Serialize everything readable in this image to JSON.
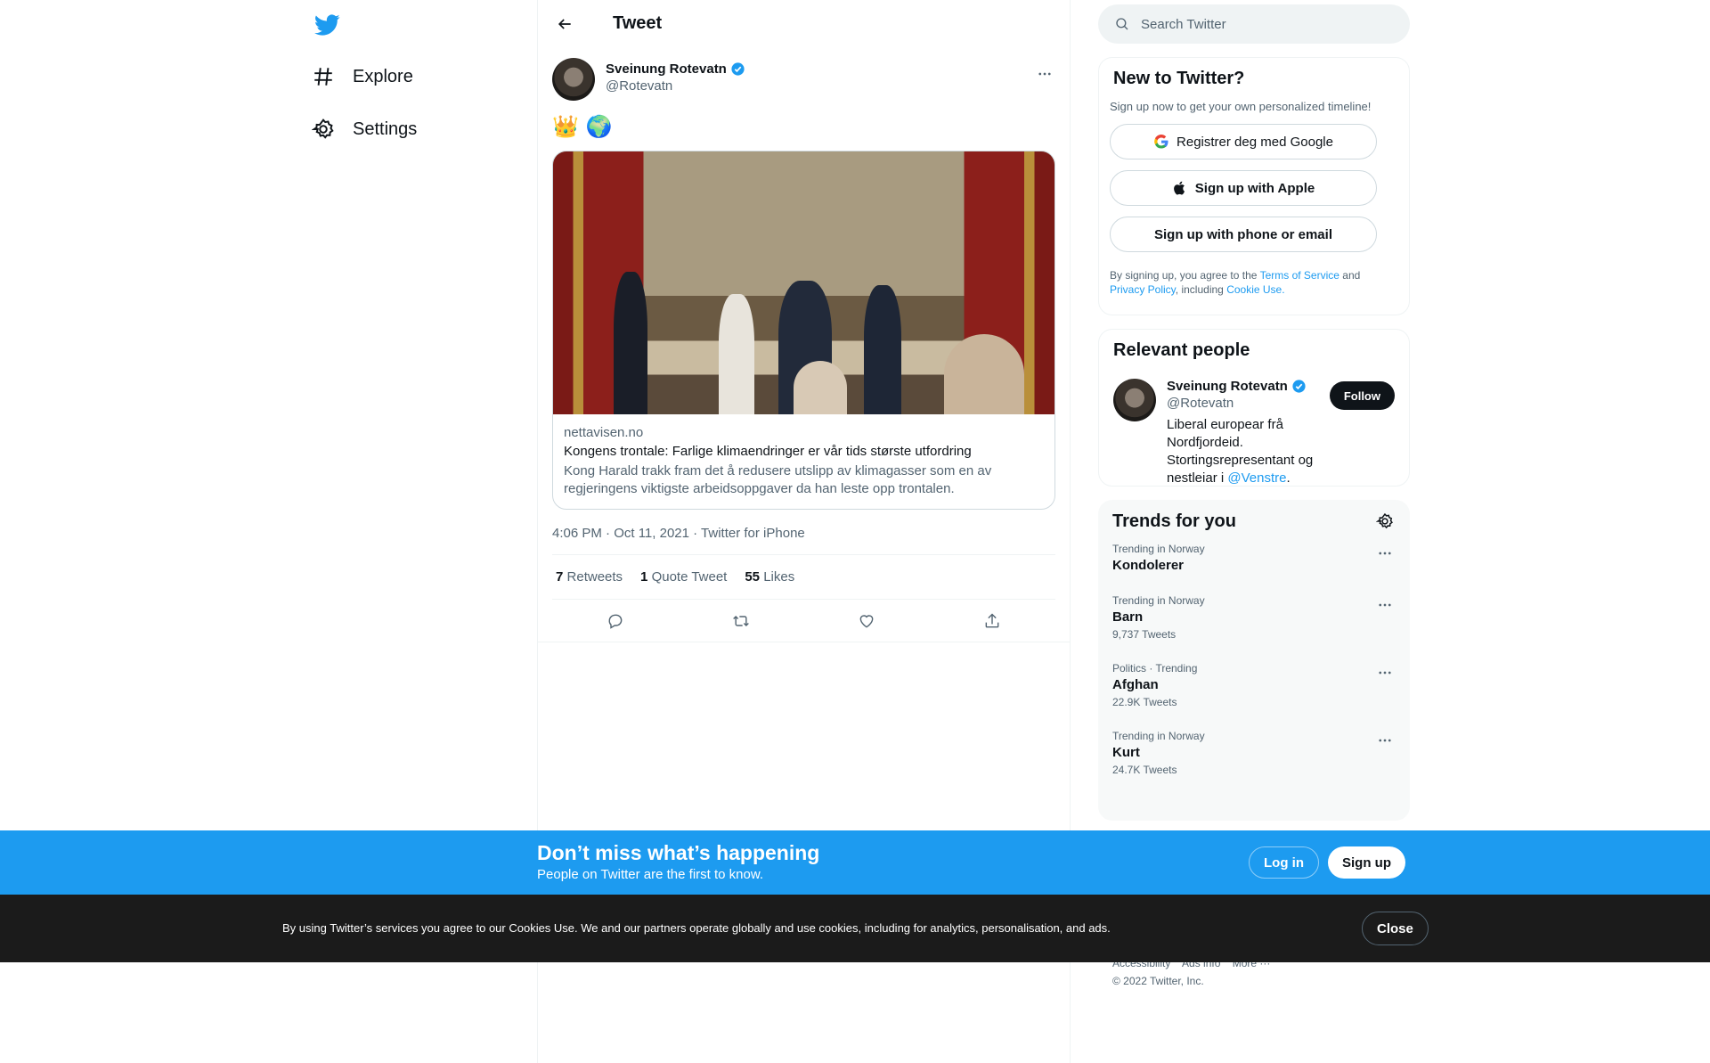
{
  "nav": {
    "items": [
      {
        "label": "Explore",
        "icon": "hashtag-icon"
      },
      {
        "label": "Settings",
        "icon": "gear-icon"
      }
    ]
  },
  "header": {
    "title": "Tweet"
  },
  "tweet": {
    "author_name": "Sveinung Rotevatn",
    "author_handle": "@Rotevatn",
    "emojis": [
      "👑",
      "🌍"
    ],
    "card": {
      "domain": "nettavisen.no",
      "title": "Kongens trontale: Farlige klimaendringer er vår tids største utfordring",
      "description": "Kong Harald trakk fram det å redusere utslipp av klimagasser som en av regjeringens viktigste arbeidsoppgaver da han leste opp trontalen."
    },
    "timestamp": "4:06 PM · Oct 11, 2021 · Twitter for iPhone",
    "stats": {
      "retweets_num": "7",
      "retweets_label": "Retweets",
      "quotes_num": "1",
      "quotes_label": "Quote Tweet",
      "likes_num": "55",
      "likes_label": "Likes"
    }
  },
  "search": {
    "placeholder": "Search Twitter"
  },
  "signup_panel": {
    "title": "New to Twitter?",
    "subtitle": "Sign up now to get your own personalized timeline!",
    "google_label": "Registrer deg med Google",
    "apple_label": "Sign up with Apple",
    "email_label": "Sign up with phone or email",
    "legal_prefix": "By signing up, you agree to the",
    "legal_terms": "Terms of Service",
    "legal_and": "and",
    "legal_privacy": "Privacy Policy",
    "legal_including": ", including",
    "legal_cookie": "Cookie Use."
  },
  "relevant": {
    "title": "Relevant people",
    "name": "Sveinung Rotevatn",
    "handle": "@Rotevatn",
    "bio": "Liberal europear frå Nordfjordeid. Stortingsrepresentant og nestleiar i",
    "bio_link": "@Venstre",
    "bio_end": ".",
    "follow_label": "Follow"
  },
  "trends": {
    "title": "Trends for you",
    "items": [
      {
        "meta": "Trending in Norway",
        "name": "Kondolerer",
        "count": ""
      },
      {
        "meta": "Trending in Norway",
        "name": "Barn",
        "count": "9,737 Tweets"
      },
      {
        "meta": "Politics · Trending",
        "name": "Afghan",
        "count": "22.9K Tweets"
      },
      {
        "meta": "Trending in Norway",
        "name": "Kurt",
        "count": "24.7K Tweets"
      }
    ]
  },
  "footer": {
    "accessibility": "Accessibility",
    "ads_info": "Ads info",
    "more": "More ···",
    "copyright": "© 2022 Twitter, Inc."
  },
  "promo": {
    "title": "Don’t miss what’s happening",
    "subtitle": "People on Twitter are the first to know.",
    "login_label": "Log in",
    "signup_label": "Sign up"
  },
  "cookie": {
    "text": "By using Twitter’s services you agree to our Cookies Use. We and our partners operate globally and use cookies, including for analytics, personalisation, and ads.",
    "close_label": "Close"
  },
  "colors": {
    "accent": "#1d9bf0",
    "text": "#0f1419",
    "secondary": "#536471",
    "cookie_bg": "#1b1b1b"
  }
}
